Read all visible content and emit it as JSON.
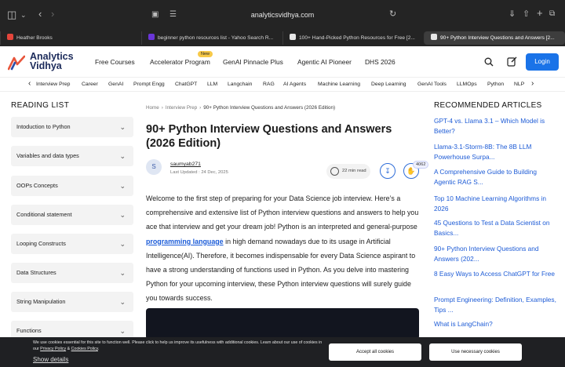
{
  "browser": {
    "url": "analyticsvidhya.com",
    "tabs": [
      {
        "label": "Heather Brooks",
        "favicon_color": "#e4453b"
      },
      {
        "label": "beginner python resources list - Yahoo Search R...",
        "favicon_color": "#6a35d8"
      },
      {
        "label": "100+ Hand-Picked Python Resources for Free [2...",
        "favicon_color": "#e6e6e6"
      },
      {
        "label": "90+ Python Interview Questions and Answers [2...",
        "favicon_color": "#e6e6e6"
      }
    ]
  },
  "header": {
    "logo_line1": "Analytics",
    "logo_line2": "Vidhya",
    "nav": [
      "Free Courses",
      "Accelerator Program",
      "GenAI Pinnacle Plus",
      "Agentic AI Pioneer",
      "DHS 2026"
    ],
    "new_badge": "New",
    "login_label": "Login",
    "brand_color": "#1a73e8"
  },
  "categories": [
    "Interview Prep",
    "Career",
    "GenAI",
    "Prompt Engg",
    "ChatGPT",
    "LLM",
    "Langchain",
    "RAG",
    "AI Agents",
    "Machine Learning",
    "Deep Learning",
    "GenAI Tools",
    "LLMOps",
    "Python",
    "NLP"
  ],
  "reading_list": {
    "title": "READING LIST",
    "items": [
      "Intoduction to Python",
      "Variables and data types",
      "OOPs Concepts",
      "Conditional statement",
      "Looping Constructs",
      "Data Structures",
      "String Manipulation",
      "Functions"
    ]
  },
  "article": {
    "breadcrumb": [
      "Home",
      "Interview Prep",
      "90+ Python Interview Questions and Answers (2026 Edition)"
    ],
    "title": "90+ Python Interview Questions and Answers (2026 Edition)",
    "author_initial": "S",
    "author": "saumyab271",
    "updated": "Last Updated : 24 Dec, 2025",
    "read_time": "22 min read",
    "claps": "4062",
    "para_before": "Welcome to the first step of preparing for your Data Science job interview. Here’s a comprehensive and extensive list of Python interview questions and answers to help you ace that interview and get your dream job! Python is an interpreted and general-purpose ",
    "link_text": "programming language",
    "para_after": " in high demand nowadays due to its usage in Artificial Intelligence(AI). Therefore, it becomes indispensable for every Data Science aspirant to have a strong understanding of functions used in Python. As you delve into mastering Python for your upcoming interview, these Python interview questions will surely guide you towards success."
  },
  "recommended": {
    "title": "RECOMMENDED ARTICLES",
    "items": [
      "GPT-4 vs. Llama 3.1 – Which Model is Better?",
      "Llama-3.1-Storm-8B: The 8B LLM Powerhouse Surpa...",
      "A Comprehensive Guide to Building Agentic RAG S...",
      "Top 10 Machine Learning Algorithms in 2026",
      "45 Questions to Test a Data Scientist on Basics...",
      "90+ Python Interview Questions and Answers (202...",
      "8 Easy Ways to Access ChatGPT for Free",
      "Prompt Engineering: Definition, Examples, Tips ...",
      "What is LangChain?"
    ]
  },
  "cookie": {
    "text_before": "We use cookies essential for this site to function well. Please click to help us improve its usefulness with additional cookies. Learn about our use of cookies in our ",
    "privacy_link": "Privacy Policy",
    "amp": " & ",
    "cookies_link": "Cookies Policy",
    "text_end": ".",
    "details": "Show details",
    "accept_label": "Accept all cookies",
    "necessary_label": "Use necessary cookies"
  }
}
